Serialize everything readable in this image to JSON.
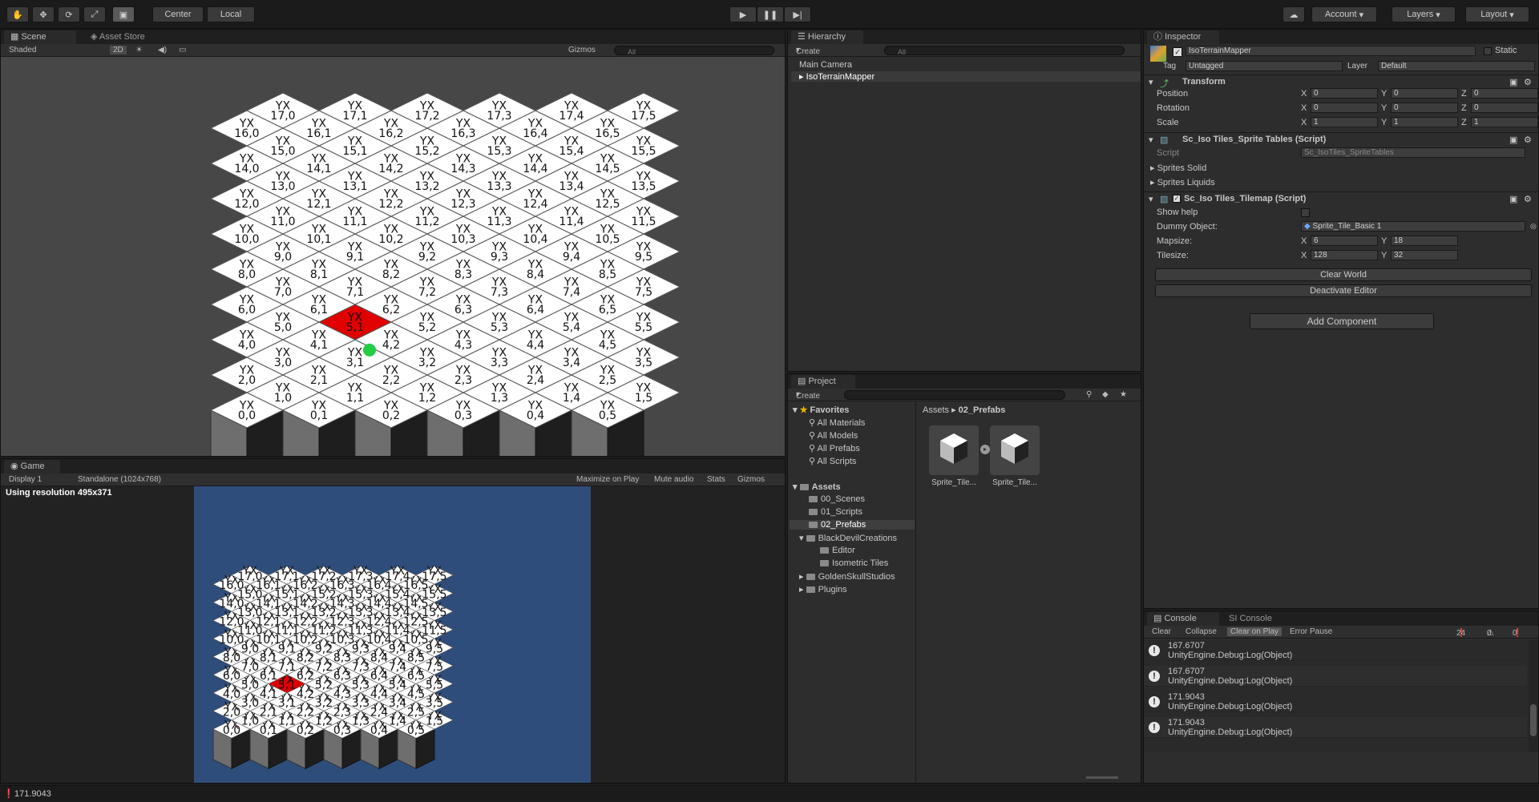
{
  "toolbar": {
    "pivot_center": "Center",
    "pivot_local": "Local",
    "account": "Account",
    "layers": "Layers",
    "layout": "Layout"
  },
  "scene": {
    "tab_scene": "Scene",
    "tab_asset_store": "Asset Store",
    "shading": "Shaded",
    "mode_2d": "2D",
    "gizmos": "Gizmos",
    "search_placeholder": "All",
    "tile_prefix": "YX",
    "rows": 18,
    "cols": 6,
    "selected_tile": "5,1",
    "tile_colors": {
      "tile": "#ffffff",
      "selected": "#e00000",
      "marker": "#22cc44",
      "bg": "#474747"
    }
  },
  "game": {
    "tab_game": "Game",
    "display": "Display 1",
    "resolution": "Standalone (1024x768)",
    "maximize": "Maximize on Play",
    "mute": "Mute audio",
    "stats": "Stats",
    "gizmos": "Gizmos",
    "using_resolution": "Using resolution 495x371",
    "bg_color": "#2f4d7a"
  },
  "hierarchy": {
    "tab": "Hierarchy",
    "create": "Create",
    "search_placeholder": "All",
    "items": [
      "Main Camera",
      "IsoTerrainMapper"
    ]
  },
  "project": {
    "tab": "Project",
    "create": "Create",
    "favorites_label": "Favorites",
    "favorites": [
      "All Materials",
      "All Models",
      "All Prefabs",
      "All Scripts"
    ],
    "assets_label": "Assets",
    "folders": [
      "00_Scenes",
      "01_Scripts",
      "02_Prefabs",
      "BlackDevilCreations",
      "Editor",
      "Isometric Tiles",
      "GoldenSkullStudios",
      "Plugins"
    ],
    "breadcrumb_root": "Assets",
    "breadcrumb_current": "02_Prefabs",
    "asset_items": [
      "Sprite_Tile...",
      "Sprite_Tile..."
    ]
  },
  "inspector": {
    "tab": "Inspector",
    "object_name": "IsoTerrainMapper",
    "static_label": "Static",
    "tag_label": "Tag",
    "tag_value": "Untagged",
    "layer_label": "Layer",
    "layer_value": "Default",
    "transform_title": "Transform",
    "position_label": "Position",
    "rotation_label": "Rotation",
    "scale_label": "Scale",
    "axis_x": "X",
    "axis_y": "Y",
    "axis_z": "Z",
    "position": [
      "0",
      "0",
      "0"
    ],
    "rotation": [
      "0",
      "0",
      "0"
    ],
    "scale": [
      "1",
      "1",
      "1"
    ],
    "sprite_tables_title": "Sc_Iso Tiles_Sprite Tables (Script)",
    "script_label": "Script",
    "script_value": "Sc_IsoTiles_SpriteTables",
    "sprites_solid": "Sprites Solid",
    "sprites_liquids": "Sprites Liquids",
    "tilemap_title": "Sc_Iso Tiles_Tilemap (Script)",
    "show_help": "Show help",
    "dummy_label": "Dummy Object:",
    "dummy_value": "Sprite_Tile_Basic 1",
    "mapsize_label": "Mapsize:",
    "mapsize_x": "6",
    "mapsize_y": "18",
    "tilesize_label": "Tilesize:",
    "tilesize_x": "128",
    "tilesize_y": "32",
    "clear_world": "Clear World",
    "deactivate_editor": "Deactivate Editor",
    "add_component": "Add Component"
  },
  "console": {
    "tab": "Console",
    "tab_si": "SI Console",
    "clear": "Clear",
    "collapse": "Collapse",
    "clear_on_play": "Clear on Play",
    "error_pause": "Error Pause",
    "count_info": "24",
    "count_warn": "0",
    "count_error": "0",
    "logs": [
      {
        "value": "167.6707",
        "source": "UnityEngine.Debug:Log(Object)"
      },
      {
        "value": "167.6707",
        "source": "UnityEngine.Debug:Log(Object)"
      },
      {
        "value": "171.9043",
        "source": "UnityEngine.Debug:Log(Object)"
      },
      {
        "value": "171.9043",
        "source": "UnityEngine.Debug:Log(Object)"
      }
    ]
  },
  "statusbar": {
    "text": "171.9043"
  }
}
